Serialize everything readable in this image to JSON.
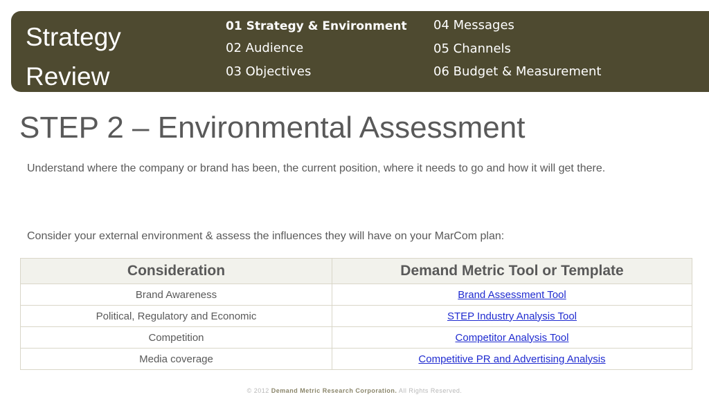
{
  "header": {
    "brand_line1": "Strategy",
    "brand_line2": "Review",
    "nav": [
      {
        "label": "01 Strategy & Environment",
        "active": true
      },
      {
        "label": "02 Audience"
      },
      {
        "label": "03 Objectives"
      },
      {
        "label": "04 Messages"
      },
      {
        "label": "05 Channels"
      },
      {
        "label": "06 Budget & Measurement"
      }
    ],
    "bg_color": "#4e4a30"
  },
  "main": {
    "title": "STEP 2 – Environmental Assessment",
    "intro": "Understand where the company or brand has been, the current position, where it needs to go and how it will get there.",
    "prompt": "Consider your external environment & assess the influences they will have on your MarCom plan:"
  },
  "table": {
    "headers": [
      "Consideration",
      "Demand Metric Tool or Template"
    ],
    "rows": [
      {
        "consideration": "Brand Awareness",
        "tool": "Brand Assessment Tool"
      },
      {
        "consideration": "Political, Regulatory and Economic",
        "tool": "STEP Industry Analysis Tool"
      },
      {
        "consideration": "Competition",
        "tool": "Competitor Analysis Tool"
      },
      {
        "consideration": "Media coverage",
        "tool": "Competitive PR and Advertising Analysis"
      }
    ],
    "link_color": "#1f2bd0"
  },
  "footer": {
    "copyright": "© 2012",
    "company": "Demand Metric Research Corporation.",
    "rights": "All Rights Reserved."
  }
}
